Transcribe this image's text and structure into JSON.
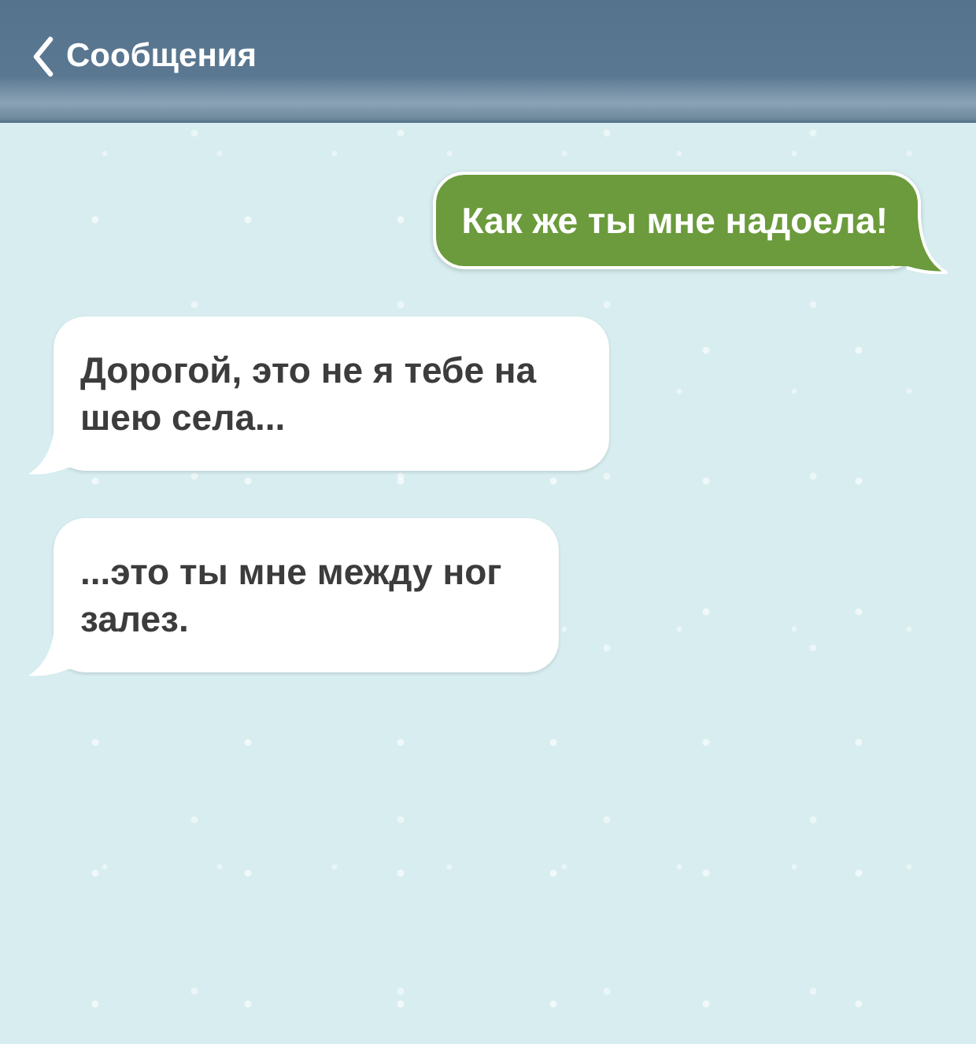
{
  "header": {
    "back_label": "Сообщения"
  },
  "messages": [
    {
      "kind": "sent",
      "text": "Как же ты мне надоела!"
    },
    {
      "kind": "received",
      "text": "Дорогой, это не я тебе на шею села..."
    },
    {
      "kind": "received",
      "text": "...это ты мне между ног залез."
    }
  ]
}
